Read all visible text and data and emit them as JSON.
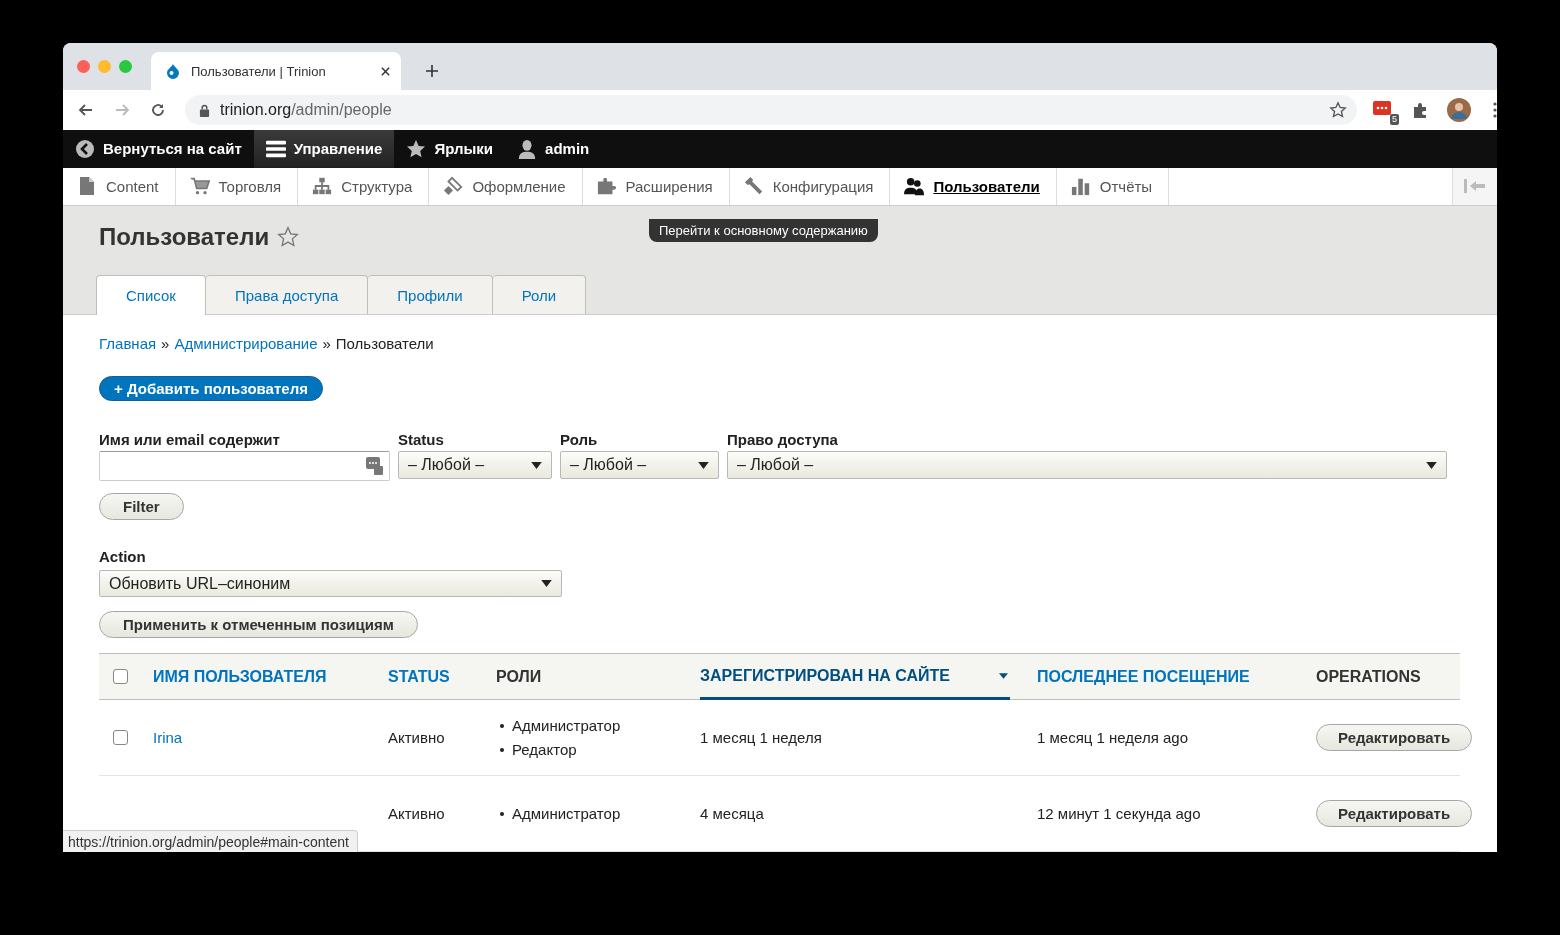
{
  "browser": {
    "tab_title": "Пользователи | Trinion",
    "url_host": "trinion.org",
    "url_path": "/admin/people",
    "extension_badge": "5"
  },
  "toolbar": [
    {
      "label": "Вернуться на сайт",
      "selected": false
    },
    {
      "label": "Управление",
      "selected": true
    },
    {
      "label": "Ярлыки",
      "selected": false
    },
    {
      "label": "admin",
      "selected": false
    }
  ],
  "tray": [
    {
      "label": "Content",
      "selected": false
    },
    {
      "label": "Торговля",
      "selected": false
    },
    {
      "label": "Структура",
      "selected": false
    },
    {
      "label": "Оформление",
      "selected": false
    },
    {
      "label": "Расширения",
      "selected": false
    },
    {
      "label": "Конфигурация",
      "selected": false
    },
    {
      "label": "Пользователи",
      "selected": true
    },
    {
      "label": "Отчёты",
      "selected": false
    }
  ],
  "skip_link": "Перейти к основному содержанию",
  "page_title": "Пользователи",
  "tabs": [
    {
      "label": "Список",
      "selected": true
    },
    {
      "label": "Права доступа",
      "selected": false
    },
    {
      "label": "Профили",
      "selected": false
    },
    {
      "label": "Роли",
      "selected": false
    }
  ],
  "breadcrumb": {
    "separator": "»",
    "items": [
      {
        "label": "Главная",
        "kind": "link"
      },
      {
        "label": "Администрирование",
        "kind": "link"
      },
      {
        "label": "Пользователи",
        "kind": "current"
      }
    ]
  },
  "add_button": "+ Добавить пользователя",
  "filters": [
    {
      "label": "Имя или email содержит",
      "kind": "text"
    },
    {
      "label": "Status",
      "kind": "select",
      "value": "– Любой –"
    },
    {
      "label": "Роль",
      "kind": "select",
      "value": "– Любой –"
    },
    {
      "label": "Право доступа",
      "kind": "select",
      "value": "– Любой –"
    }
  ],
  "filter_button": "Filter",
  "action": {
    "label": "Action",
    "value": "Обновить URL–синоним"
  },
  "apply_button": "Применить к отмеченным позициям",
  "table": {
    "select_all_checked": false,
    "columns": [
      {
        "label": "ИМЯ ПОЛЬЗОВАТЕЛЯ",
        "kind": "link",
        "sorted": false
      },
      {
        "label": "STATUS",
        "kind": "link",
        "sorted": false
      },
      {
        "label": "РОЛИ",
        "kind": "plain",
        "sorted": false
      },
      {
        "label": "ЗАРЕГИСТРИРОВАН НА САЙТЕ",
        "kind": "link",
        "sorted": true
      },
      {
        "label": "ПОСЛЕДНЕЕ ПОСЕЩЕНИЕ",
        "kind": "link",
        "sorted": false
      },
      {
        "label": "OPERATIONS",
        "kind": "plain",
        "sorted": false
      }
    ],
    "rows": [
      {
        "name": "Irina",
        "checked": false,
        "status": "Активно",
        "roles": [
          "Администратор",
          "Редактор"
        ],
        "registered": "1 месяц 1 неделя",
        "last_access": "1 месяц 1 неделя ago",
        "operation": "Редактировать"
      },
      {
        "status": "Активно",
        "roles": [
          "Администратор"
        ],
        "registered": "4 месяца",
        "last_access": "12 минут 1 секунда ago",
        "operation": "Редактировать"
      }
    ]
  },
  "status_url": "https://trinion.org/admin/people#main-content"
}
